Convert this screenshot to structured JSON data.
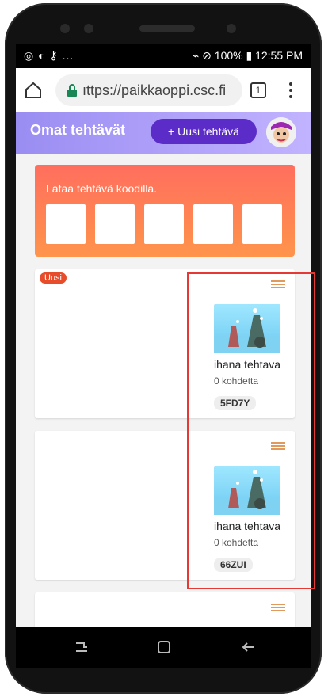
{
  "status_bar": {
    "left_icons": "◎ ◐ ⚷ ...",
    "right_text": "⌁ ⊘ 100% ▮ 12:55 PM"
  },
  "browser": {
    "url": "ıttps://paikkaoppi.csc.fi",
    "tabs_count": "1"
  },
  "app": {
    "title": "Omat tehtävät",
    "new_task_button": "+ Uusi tehtävä"
  },
  "code_entry": {
    "title": "Lataa tehtävä koodilla.",
    "box_count": 5
  },
  "tasks": [
    {
      "badge": "Uusi",
      "title": "ihana tehtava",
      "count": "0 kohdetta",
      "code": "5FD7Y"
    },
    {
      "badge": "",
      "title": "ihana tehtava",
      "count": "0 kohdetta",
      "code": "66ZUI"
    }
  ],
  "colors": {
    "header_from": "#9a8df2",
    "header_to": "#c2b3ff",
    "accent_button": "#5b2cc8",
    "code_card_from": "#ff6e5e",
    "code_card_to": "#ff944b",
    "badge": "#e74d2a",
    "highlight": "#e53935"
  }
}
